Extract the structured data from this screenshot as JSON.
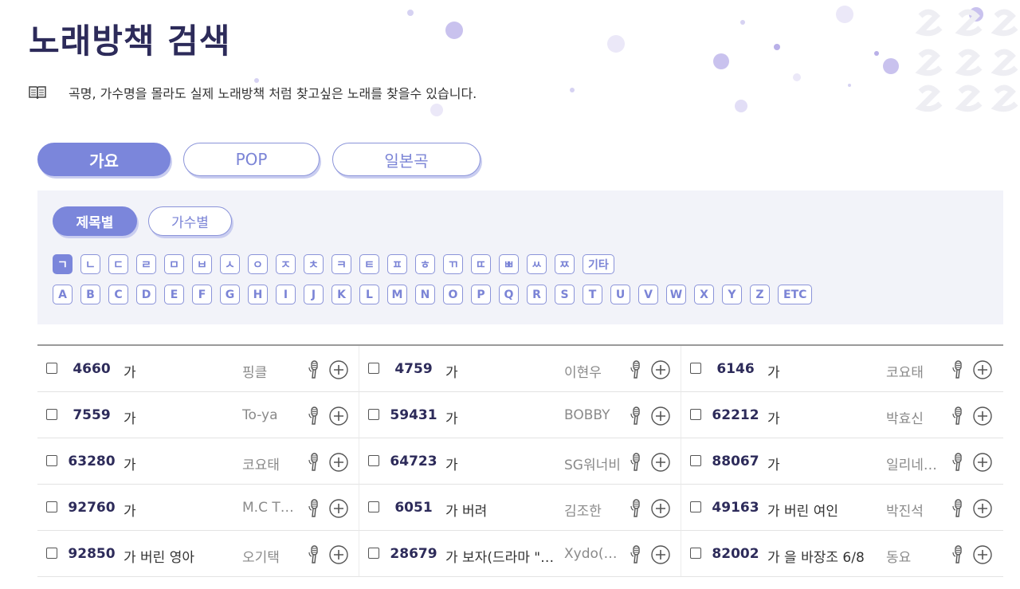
{
  "page": {
    "title": "노래방책 검색",
    "description": "곡명, 가수명을 몰라도 실제 노래방책 처럼 찾고싶은 노래를 찾을수 있습니다."
  },
  "category_tabs": [
    {
      "label": "가요",
      "active": true
    },
    {
      "label": "POP",
      "active": false
    },
    {
      "label": "일본곡",
      "active": false
    }
  ],
  "sub_tabs": [
    {
      "label": "제목별",
      "active": true
    },
    {
      "label": "가수별",
      "active": false
    }
  ],
  "korean_keys": [
    "ㄱ",
    "ㄴ",
    "ㄷ",
    "ㄹ",
    "ㅁ",
    "ㅂ",
    "ㅅ",
    "ㅇ",
    "ㅈ",
    "ㅊ",
    "ㅋ",
    "ㅌ",
    "ㅍ",
    "ㅎ",
    "ㄲ",
    "ㄸ",
    "ㅃ",
    "ㅆ",
    "ㅉ",
    "기타"
  ],
  "english_keys": [
    "A",
    "B",
    "C",
    "D",
    "E",
    "F",
    "G",
    "H",
    "I",
    "J",
    "K",
    "L",
    "M",
    "N",
    "O",
    "P",
    "Q",
    "R",
    "S",
    "T",
    "U",
    "V",
    "W",
    "X",
    "Y",
    "Z",
    "ETC"
  ],
  "selected_key": "ㄱ",
  "songs": [
    {
      "num": "4660",
      "title": "가",
      "singer": "핑클"
    },
    {
      "num": "4759",
      "title": "가",
      "singer": "이현우"
    },
    {
      "num": "6146",
      "title": "가",
      "singer": "코요태"
    },
    {
      "num": "7559",
      "title": "가",
      "singer": "To-ya"
    },
    {
      "num": "59431",
      "title": "가",
      "singer": "BOBBY"
    },
    {
      "num": "62212",
      "title": "가",
      "singer": "박효신"
    },
    {
      "num": "63280",
      "title": "가",
      "singer": "코요태"
    },
    {
      "num": "64723",
      "title": "가",
      "singer": "SG워너비"
    },
    {
      "num": "88067",
      "title": "가",
      "singer": "일리네…"
    },
    {
      "num": "92760",
      "title": "가",
      "singer": "M.C T…"
    },
    {
      "num": "6051",
      "title": "가 버려",
      "singer": "김조한"
    },
    {
      "num": "49163",
      "title": "가 버린 여인",
      "singer": "박진석"
    },
    {
      "num": "92850",
      "title": "가 버린 영아",
      "singer": "오기택"
    },
    {
      "num": "28679",
      "title": "가 보자(드라마 \"…",
      "singer": "Xydo(…"
    },
    {
      "num": "82002",
      "title": "가 을 바장조 6/8",
      "singer": "동요"
    }
  ],
  "icons": {
    "description": "book-icon",
    "sing": "microphone-icon",
    "add": "plus-circle-icon"
  },
  "colors": {
    "accent": "#7b86db",
    "title": "#2d2b5a",
    "filter_bg": "#f2f3f9"
  }
}
